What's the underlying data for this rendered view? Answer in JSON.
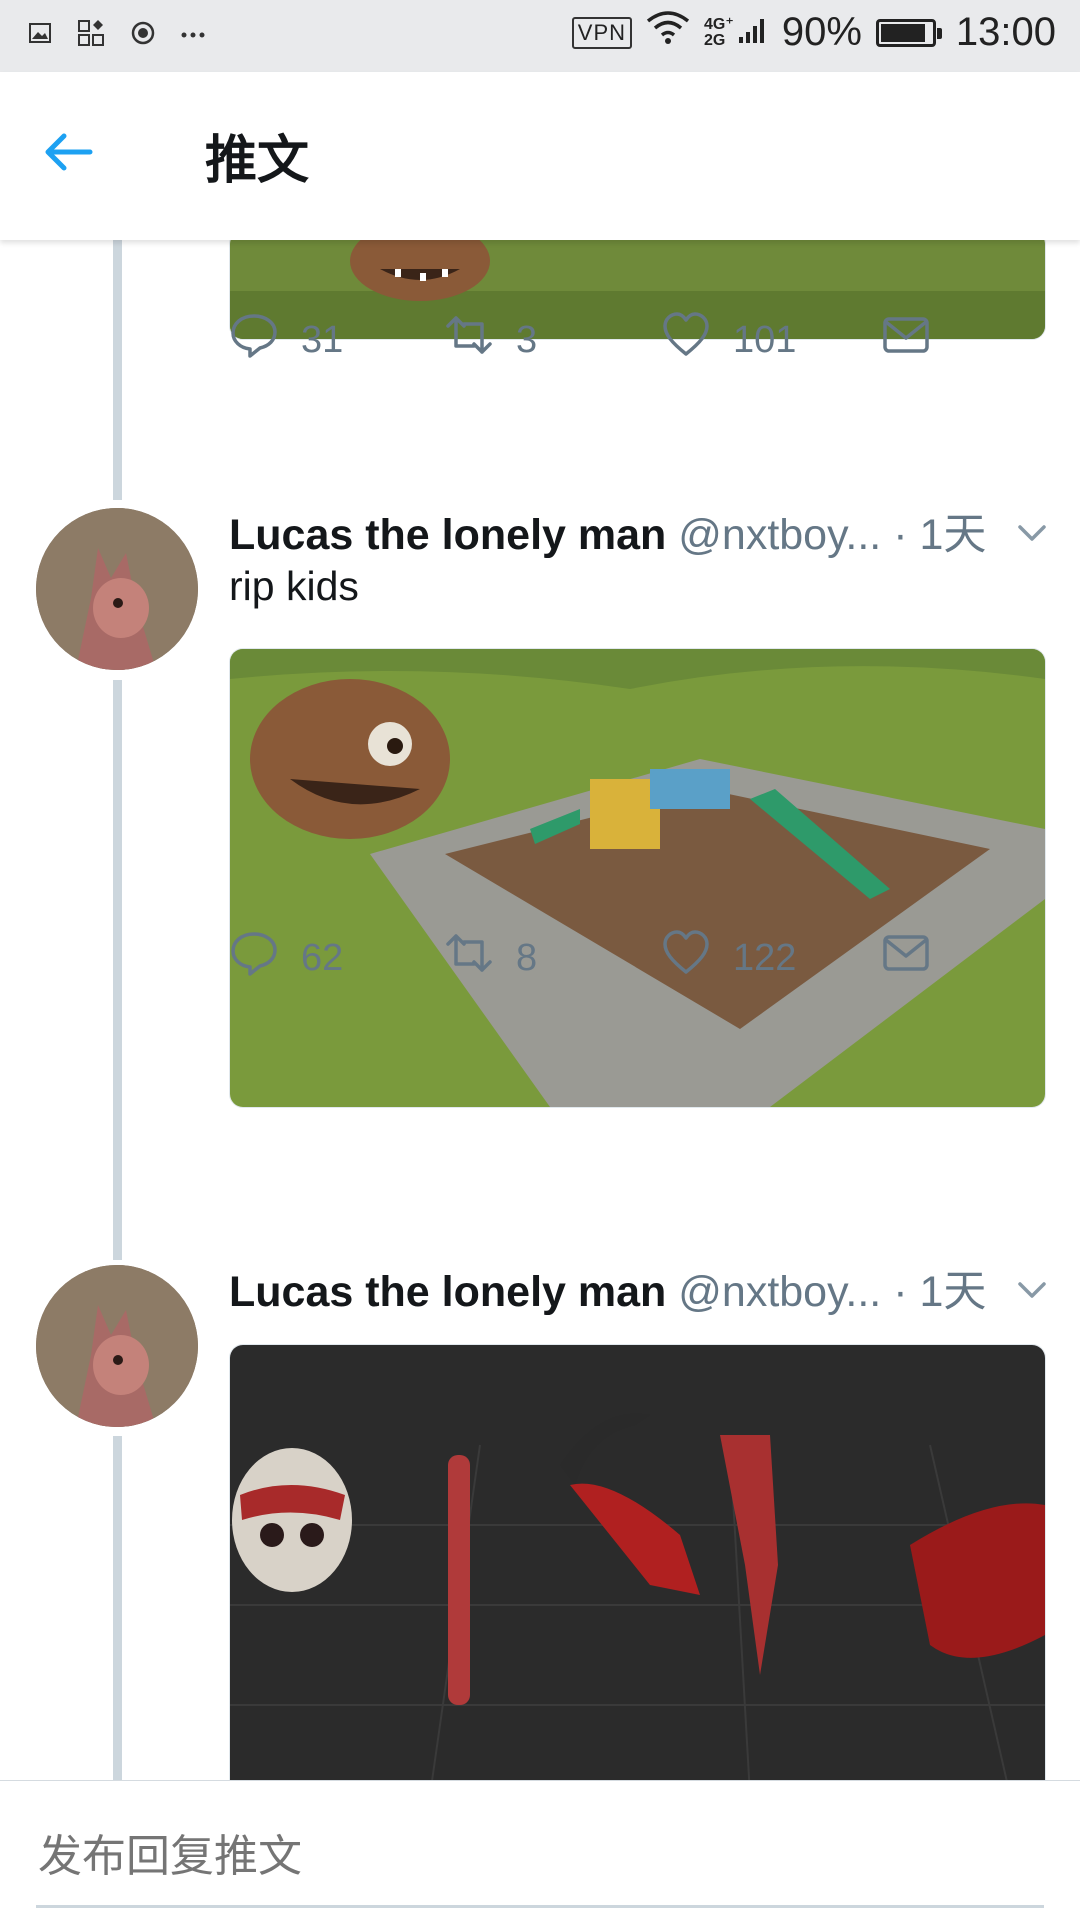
{
  "status_bar": {
    "left_icons": [
      "image-icon",
      "apps-icon",
      "record-icon",
      "more-icon"
    ],
    "vpn_label": "VPN",
    "network_top": "4G⁺",
    "network_bottom": "2G",
    "battery_percent_label": "90%",
    "battery_level": 0.9,
    "time": "13:00"
  },
  "appbar": {
    "back_icon": "arrow-left-icon",
    "title": "推文"
  },
  "tweets": [
    {
      "stats": {
        "replies": "31",
        "retweets": "3",
        "likes": "101"
      }
    },
    {
      "author_name": "Lucas the lonely man",
      "handle": "@nxtboy...",
      "time": "· 1天",
      "text": "rip kids",
      "stats": {
        "replies": "62",
        "retweets": "8",
        "likes": "122"
      }
    },
    {
      "author_name": "Lucas the lonely man",
      "handle": "@nxtboy...",
      "time": "· 1天"
    }
  ],
  "composer": {
    "placeholder": "发布回复推文"
  },
  "colors": {
    "accent": "#1da1f2",
    "secondary_text": "#657786",
    "thread_line": "#ccd6dd"
  }
}
